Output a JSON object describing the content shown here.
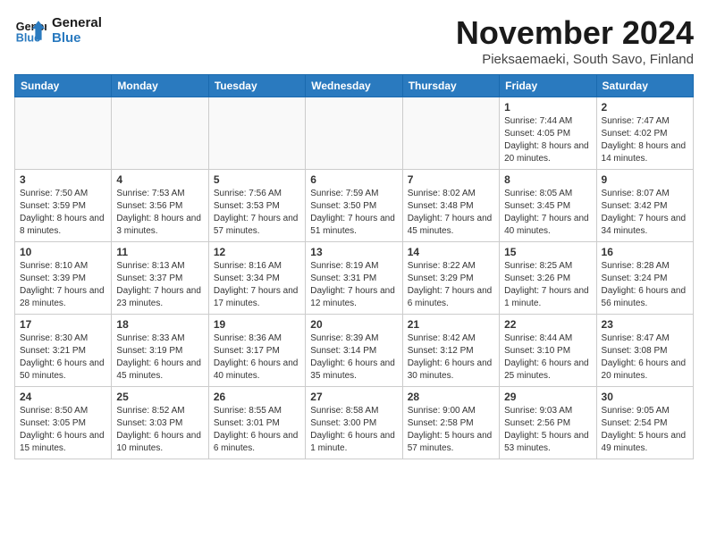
{
  "header": {
    "logo_line1": "General",
    "logo_line2": "Blue",
    "month_title": "November 2024",
    "location": "Pieksaemaeki, South Savo, Finland"
  },
  "weekdays": [
    "Sunday",
    "Monday",
    "Tuesday",
    "Wednesday",
    "Thursday",
    "Friday",
    "Saturday"
  ],
  "weeks": [
    [
      {
        "day": "",
        "info": ""
      },
      {
        "day": "",
        "info": ""
      },
      {
        "day": "",
        "info": ""
      },
      {
        "day": "",
        "info": ""
      },
      {
        "day": "",
        "info": ""
      },
      {
        "day": "1",
        "info": "Sunrise: 7:44 AM\nSunset: 4:05 PM\nDaylight: 8 hours and 20 minutes."
      },
      {
        "day": "2",
        "info": "Sunrise: 7:47 AM\nSunset: 4:02 PM\nDaylight: 8 hours and 14 minutes."
      }
    ],
    [
      {
        "day": "3",
        "info": "Sunrise: 7:50 AM\nSunset: 3:59 PM\nDaylight: 8 hours and 8 minutes."
      },
      {
        "day": "4",
        "info": "Sunrise: 7:53 AM\nSunset: 3:56 PM\nDaylight: 8 hours and 3 minutes."
      },
      {
        "day": "5",
        "info": "Sunrise: 7:56 AM\nSunset: 3:53 PM\nDaylight: 7 hours and 57 minutes."
      },
      {
        "day": "6",
        "info": "Sunrise: 7:59 AM\nSunset: 3:50 PM\nDaylight: 7 hours and 51 minutes."
      },
      {
        "day": "7",
        "info": "Sunrise: 8:02 AM\nSunset: 3:48 PM\nDaylight: 7 hours and 45 minutes."
      },
      {
        "day": "8",
        "info": "Sunrise: 8:05 AM\nSunset: 3:45 PM\nDaylight: 7 hours and 40 minutes."
      },
      {
        "day": "9",
        "info": "Sunrise: 8:07 AM\nSunset: 3:42 PM\nDaylight: 7 hours and 34 minutes."
      }
    ],
    [
      {
        "day": "10",
        "info": "Sunrise: 8:10 AM\nSunset: 3:39 PM\nDaylight: 7 hours and 28 minutes."
      },
      {
        "day": "11",
        "info": "Sunrise: 8:13 AM\nSunset: 3:37 PM\nDaylight: 7 hours and 23 minutes."
      },
      {
        "day": "12",
        "info": "Sunrise: 8:16 AM\nSunset: 3:34 PM\nDaylight: 7 hours and 17 minutes."
      },
      {
        "day": "13",
        "info": "Sunrise: 8:19 AM\nSunset: 3:31 PM\nDaylight: 7 hours and 12 minutes."
      },
      {
        "day": "14",
        "info": "Sunrise: 8:22 AM\nSunset: 3:29 PM\nDaylight: 7 hours and 6 minutes."
      },
      {
        "day": "15",
        "info": "Sunrise: 8:25 AM\nSunset: 3:26 PM\nDaylight: 7 hours and 1 minute."
      },
      {
        "day": "16",
        "info": "Sunrise: 8:28 AM\nSunset: 3:24 PM\nDaylight: 6 hours and 56 minutes."
      }
    ],
    [
      {
        "day": "17",
        "info": "Sunrise: 8:30 AM\nSunset: 3:21 PM\nDaylight: 6 hours and 50 minutes."
      },
      {
        "day": "18",
        "info": "Sunrise: 8:33 AM\nSunset: 3:19 PM\nDaylight: 6 hours and 45 minutes."
      },
      {
        "day": "19",
        "info": "Sunrise: 8:36 AM\nSunset: 3:17 PM\nDaylight: 6 hours and 40 minutes."
      },
      {
        "day": "20",
        "info": "Sunrise: 8:39 AM\nSunset: 3:14 PM\nDaylight: 6 hours and 35 minutes."
      },
      {
        "day": "21",
        "info": "Sunrise: 8:42 AM\nSunset: 3:12 PM\nDaylight: 6 hours and 30 minutes."
      },
      {
        "day": "22",
        "info": "Sunrise: 8:44 AM\nSunset: 3:10 PM\nDaylight: 6 hours and 25 minutes."
      },
      {
        "day": "23",
        "info": "Sunrise: 8:47 AM\nSunset: 3:08 PM\nDaylight: 6 hours and 20 minutes."
      }
    ],
    [
      {
        "day": "24",
        "info": "Sunrise: 8:50 AM\nSunset: 3:05 PM\nDaylight: 6 hours and 15 minutes."
      },
      {
        "day": "25",
        "info": "Sunrise: 8:52 AM\nSunset: 3:03 PM\nDaylight: 6 hours and 10 minutes."
      },
      {
        "day": "26",
        "info": "Sunrise: 8:55 AM\nSunset: 3:01 PM\nDaylight: 6 hours and 6 minutes."
      },
      {
        "day": "27",
        "info": "Sunrise: 8:58 AM\nSunset: 3:00 PM\nDaylight: 6 hours and 1 minute."
      },
      {
        "day": "28",
        "info": "Sunrise: 9:00 AM\nSunset: 2:58 PM\nDaylight: 5 hours and 57 minutes."
      },
      {
        "day": "29",
        "info": "Sunrise: 9:03 AM\nSunset: 2:56 PM\nDaylight: 5 hours and 53 minutes."
      },
      {
        "day": "30",
        "info": "Sunrise: 9:05 AM\nSunset: 2:54 PM\nDaylight: 5 hours and 49 minutes."
      }
    ]
  ]
}
